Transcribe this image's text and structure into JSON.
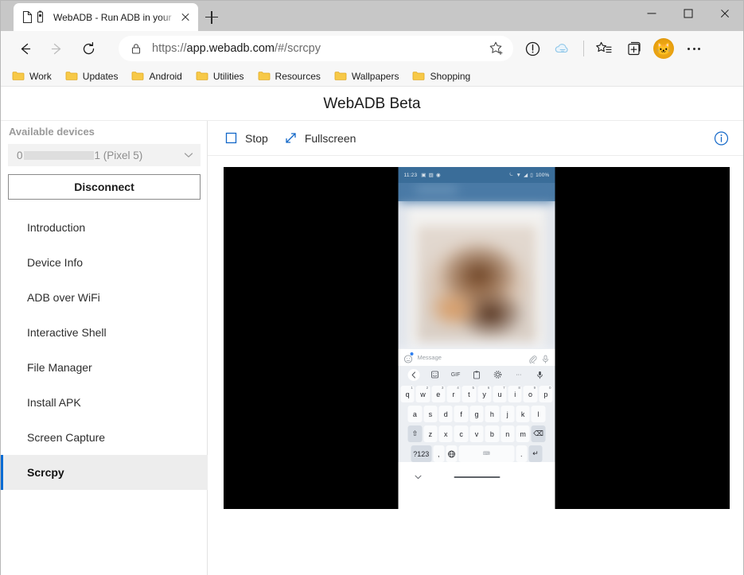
{
  "browser": {
    "tab": {
      "title": "WebADB - Run ADB in your",
      "page_icon": "page-icon",
      "usb_icon": "usb-device-icon",
      "close_icon": "close-icon"
    },
    "new_tab_label": "+",
    "window_controls": {
      "minimize": "minimize-icon",
      "maximize": "maximize-icon",
      "close": "close-icon"
    },
    "nav": {
      "back_icon": "arrow-left-icon",
      "forward_icon": "arrow-right-icon",
      "refresh_icon": "refresh-icon"
    },
    "omnibox": {
      "lock_icon": "lock-icon",
      "url_scheme": "https://",
      "url_domain": "app.webadb.com",
      "url_path": "/#/scrcpy",
      "url_full": "https://app.webadb.com/#/scrcpy",
      "favorite_icon": "star-add-icon"
    },
    "toolbar_icons": [
      {
        "name": "tracking-prevention-icon"
      },
      {
        "name": "cloud-sync-icon"
      },
      {
        "name": "favorites-icon"
      },
      {
        "name": "collections-icon"
      },
      {
        "name": "profile-avatar"
      },
      {
        "name": "settings-more-icon"
      }
    ],
    "bookmarks": [
      {
        "label": "Work",
        "icon": "folder-icon"
      },
      {
        "label": "Updates",
        "icon": "folder-icon"
      },
      {
        "label": "Android",
        "icon": "folder-icon"
      },
      {
        "label": "Utilities",
        "icon": "folder-icon"
      },
      {
        "label": "Resources",
        "icon": "folder-icon"
      },
      {
        "label": "Wallpapers",
        "icon": "folder-icon"
      },
      {
        "label": "Shopping",
        "icon": "folder-icon"
      }
    ]
  },
  "app": {
    "title": "WebADB Beta",
    "accent_color": "#0b6cd4",
    "sidebar": {
      "section_label": "Available devices",
      "device_select": {
        "value_prefix": "0",
        "value_suffix": "1 (Pixel 5)",
        "redacted": true,
        "chevron_icon": "chevron-down-icon"
      },
      "disconnect_label": "Disconnect",
      "items": [
        {
          "label": "Introduction",
          "active": false
        },
        {
          "label": "Device Info",
          "active": false
        },
        {
          "label": "ADB over WiFi",
          "active": false
        },
        {
          "label": "Interactive Shell",
          "active": false
        },
        {
          "label": "File Manager",
          "active": false
        },
        {
          "label": "Install APK",
          "active": false
        },
        {
          "label": "Screen Capture",
          "active": false
        },
        {
          "label": "Scrcpy",
          "active": true
        }
      ]
    },
    "toolbar": {
      "stop_label": "Stop",
      "stop_icon": "stop-square-icon",
      "fullscreen_label": "Fullscreen",
      "fullscreen_icon": "fullscreen-arrow-icon",
      "info_icon": "info-circle-icon"
    }
  },
  "device_screen": {
    "statusbar": {
      "time": "11:23",
      "left_icons": [
        "cast-icon",
        "photo-icon",
        "chrome-icon"
      ],
      "right_icons": [
        "alarm-icon",
        "wifi-icon",
        "signal-icon",
        "battery-icon"
      ],
      "battery": "100%"
    },
    "content": "blurred-app-content",
    "message_bar": {
      "emoji_icon": "emoji-icon",
      "placeholder": "Message",
      "attach_icon": "paperclip-icon",
      "mic_icon": "microphone-icon"
    },
    "keyboard_toolbar": [
      {
        "icon": "chevron-left-icon",
        "label": ""
      },
      {
        "icon": "sticker-icon",
        "label": ""
      },
      {
        "icon": "gif-icon",
        "label": "GIF"
      },
      {
        "icon": "clipboard-icon",
        "label": ""
      },
      {
        "icon": "settings-gear-icon",
        "label": ""
      },
      {
        "icon": "more-dots-icon",
        "label": "···"
      },
      {
        "icon": "microphone-icon",
        "label": ""
      }
    ],
    "keyboard": {
      "row1": [
        {
          "key": "q",
          "num": "1"
        },
        {
          "key": "w",
          "num": "2"
        },
        {
          "key": "e",
          "num": "3"
        },
        {
          "key": "r",
          "num": "4"
        },
        {
          "key": "t",
          "num": "5"
        },
        {
          "key": "y",
          "num": "6"
        },
        {
          "key": "u",
          "num": "7"
        },
        {
          "key": "i",
          "num": "8"
        },
        {
          "key": "o",
          "num": "9"
        },
        {
          "key": "p",
          "num": "0"
        }
      ],
      "row2": [
        {
          "key": "a"
        },
        {
          "key": "s"
        },
        {
          "key": "d"
        },
        {
          "key": "f"
        },
        {
          "key": "g"
        },
        {
          "key": "h"
        },
        {
          "key": "j"
        },
        {
          "key": "k"
        },
        {
          "key": "l"
        }
      ],
      "row3": [
        {
          "key": "⇧",
          "name": "shift-key",
          "dark": true
        },
        {
          "key": "z"
        },
        {
          "key": "x"
        },
        {
          "key": "c"
        },
        {
          "key": "v"
        },
        {
          "key": "b"
        },
        {
          "key": "n"
        },
        {
          "key": "m"
        },
        {
          "key": "⌫",
          "name": "backspace-key",
          "dark": true
        }
      ],
      "row4": [
        {
          "key": "?123",
          "name": "symbols-key",
          "dark": true
        },
        {
          "key": ",",
          "name": "comma-key"
        },
        {
          "key": "⊕",
          "name": "language-globe-key"
        },
        {
          "key": "",
          "name": "space-key"
        },
        {
          "key": ".",
          "name": "period-key"
        },
        {
          "key": "↵",
          "name": "enter-key",
          "dark": true
        }
      ]
    },
    "nav_gesture": {
      "hide_keyboard_icon": "chevron-down-icon",
      "home_indicator": "home-gesture-bar"
    }
  }
}
